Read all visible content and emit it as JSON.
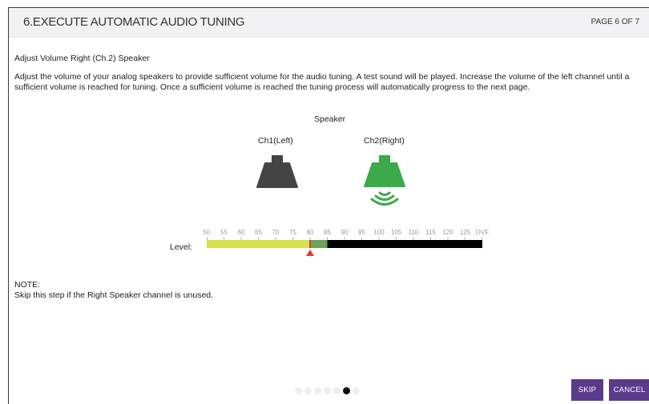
{
  "header": {
    "title": "6.EXECUTE AUTOMATIC AUDIO TUNING",
    "page_indicator": "PAGE 6 OF 7"
  },
  "content": {
    "subtitle": "Adjust Volume Right (Ch.2) Speaker",
    "description": "Adjust the volume of your analog speakers to provide sufficient volume for the audio tuning. A test sound will be played. Increase the volume of the left channel until a sufficient volume is reached for tuning. Once a sufficient volume is reached the tuning process will automatically progress to the next page.",
    "speaker_heading": "Speaker",
    "channels": [
      {
        "label": "Ch1(Left)",
        "active": false,
        "color": "#444444"
      },
      {
        "label": "Ch2(Right)",
        "active": true,
        "color": "#3aaa4b"
      }
    ]
  },
  "level_meter": {
    "label": "Level:",
    "scale": [
      "50",
      "55",
      "60",
      "65",
      "70",
      "75",
      "80",
      "85",
      "90",
      "95",
      "100",
      "105",
      "110",
      "115",
      "120",
      "125",
      "OVF"
    ],
    "yellow_until": "80",
    "green_until": "85",
    "marker_at": "80",
    "colors": {
      "yellow": "#d6e04c",
      "green": "#6aa35a",
      "black": "#000000",
      "marker": "#e53b2e"
    }
  },
  "note": {
    "label": "NOTE:",
    "text": "Skip this step if the Right Speaker channel is unused."
  },
  "pagination": {
    "total": 7,
    "current": 6
  },
  "buttons": {
    "skip": "SKIP",
    "cancel": "CANCEL",
    "accent": "#5b3a8c"
  }
}
